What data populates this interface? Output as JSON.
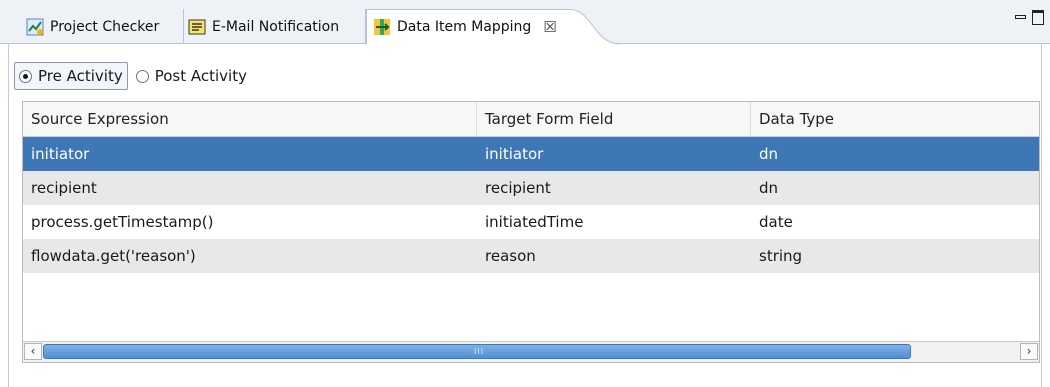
{
  "tabs": [
    {
      "label": "Project Checker",
      "icon": "project-checker-icon",
      "active": false
    },
    {
      "label": "E-Mail Notification",
      "icon": "email-notification-icon",
      "active": false
    },
    {
      "label": "Data Item Mapping",
      "icon": "data-item-mapping-icon",
      "active": true,
      "close_glyph": "☒"
    }
  ],
  "window_controls": {
    "minimize": "minimize-icon",
    "maximize": "maximize-icon"
  },
  "activity": {
    "options": [
      {
        "label": "Pre Activity",
        "checked": true
      },
      {
        "label": "Post Activity",
        "checked": false
      }
    ]
  },
  "table": {
    "columns": [
      "Source Expression",
      "Target Form Field",
      "Data Type"
    ],
    "rows": [
      {
        "source": "initiator",
        "target": "initiator",
        "type": "dn",
        "selected": true
      },
      {
        "source": "recipient",
        "target": "recipient",
        "type": "dn",
        "selected": false
      },
      {
        "source": "process.getTimestamp()",
        "target": "initiatedTime",
        "type": "date",
        "selected": false
      },
      {
        "source": "flowdata.get('reason')",
        "target": "reason",
        "type": "string",
        "selected": false
      }
    ]
  },
  "scrollbar": {
    "left_arrow": "‹",
    "right_arrow": "›",
    "grip": "III"
  },
  "colors": {
    "selection": "#3d77b5",
    "alt_row": "#e8e8e8",
    "tab_bg": "#eef2f7"
  }
}
